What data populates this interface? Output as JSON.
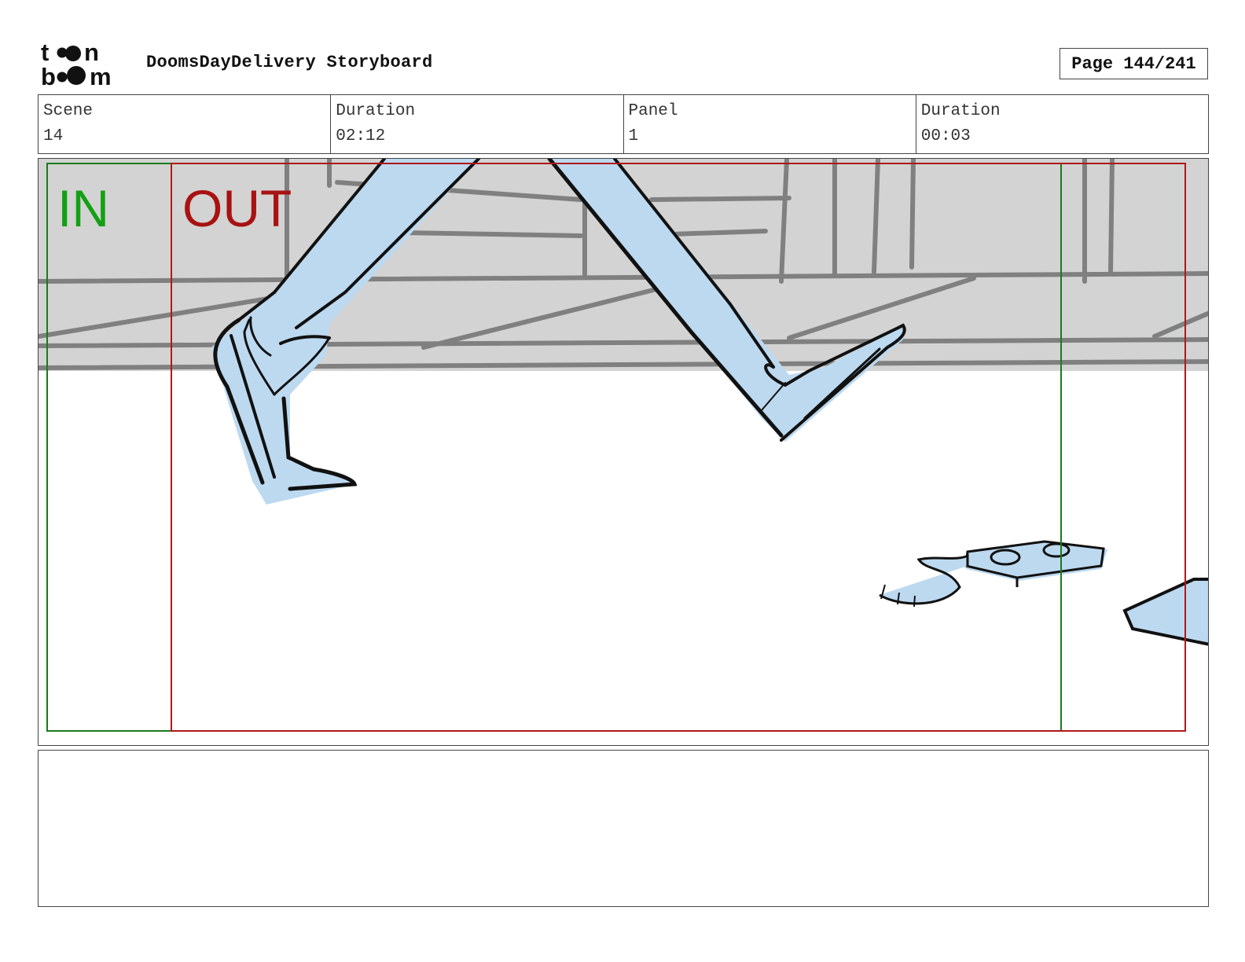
{
  "header": {
    "logo_text": "toon boom",
    "title": "DoomsDayDelivery Storyboard",
    "page": "Page 144/241"
  },
  "info": {
    "scene_label": "Scene",
    "scene_value": "14",
    "duration_label": "Duration",
    "duration_value": "02:12",
    "panel_label": "Panel",
    "panel_value": "1",
    "panel_duration_label": "Duration",
    "panel_duration_value": "00:03"
  },
  "panel": {
    "in_label": "IN",
    "out_label": "OUT",
    "colors": {
      "in_frame": "#1a7a1a",
      "in_text": "#14a014",
      "out_frame": "#b01818",
      "out_text": "#a81212",
      "wall": "#d3d3d3",
      "wall_lines": "#808080",
      "character_fill": "#bcd9f0",
      "ink": "#111111"
    }
  },
  "notes": {
    "text": ""
  }
}
